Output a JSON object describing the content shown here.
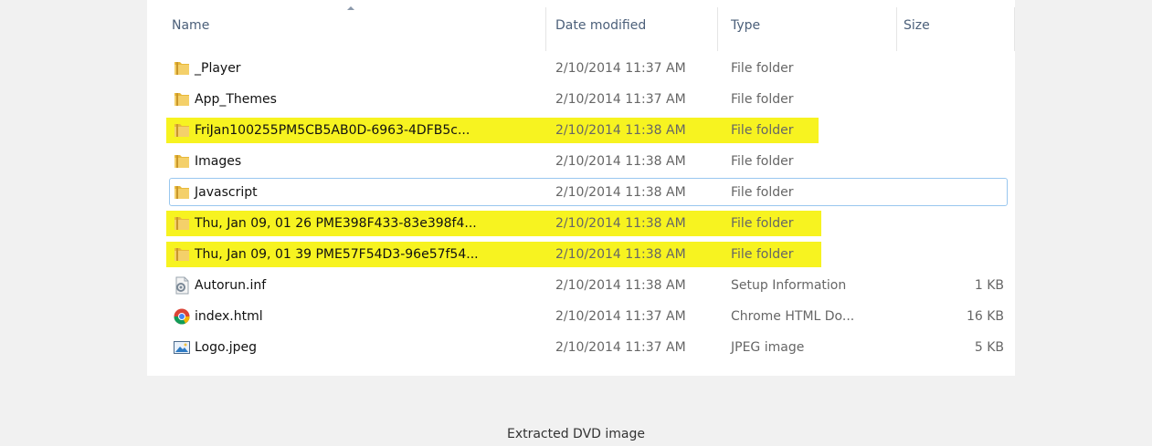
{
  "columns": {
    "name": "Name",
    "date_modified": "Date modified",
    "type": "Type",
    "size": "Size"
  },
  "files": [
    {
      "name": "_Player",
      "date": "2/10/2014 11:37 AM",
      "type": "File folder",
      "size": "",
      "icon": "folder-icon",
      "highlighted": false
    },
    {
      "name": "App_Themes",
      "date": "2/10/2014 11:37 AM",
      "type": "File folder",
      "size": "",
      "icon": "folder-icon",
      "highlighted": false
    },
    {
      "name": "FriJan100255PM5CB5AB0D-6963-4DFB5c...",
      "date": "2/10/2014 11:38 AM",
      "type": "File folder",
      "size": "",
      "icon": "folder-icon",
      "highlighted": true
    },
    {
      "name": "Images",
      "date": "2/10/2014 11:38 AM",
      "type": "File folder",
      "size": "",
      "icon": "folder-icon",
      "highlighted": false
    },
    {
      "name": "Javascript",
      "date": "2/10/2014 11:38 AM",
      "type": "File folder",
      "size": "",
      "icon": "folder-icon",
      "highlighted": false,
      "focused": true
    },
    {
      "name": "Thu, Jan 09, 01 26 PME398F433-83e398f4...",
      "date": "2/10/2014 11:38 AM",
      "type": "File folder",
      "size": "",
      "icon": "folder-icon",
      "highlighted": true
    },
    {
      "name": "Thu, Jan 09, 01 39 PME57F54D3-96e57f54...",
      "date": "2/10/2014 11:38 AM",
      "type": "File folder",
      "size": "",
      "icon": "folder-icon",
      "highlighted": true
    },
    {
      "name": "Autorun.inf",
      "date": "2/10/2014 11:38 AM",
      "type": "Setup Information",
      "size": "1 KB",
      "icon": "settings-file-icon",
      "highlighted": false
    },
    {
      "name": "index.html",
      "date": "2/10/2014 11:37 AM",
      "type": "Chrome HTML Do...",
      "size": "16 KB",
      "icon": "chrome-icon",
      "highlighted": false
    },
    {
      "name": "Logo.jpeg",
      "date": "2/10/2014 11:37 AM",
      "type": "JPEG image",
      "size": "5 KB",
      "icon": "image-file-icon",
      "highlighted": false
    }
  ],
  "caption": "Extracted DVD image",
  "colors": {
    "highlight": "#f7f320",
    "folder": "#e8b93a",
    "focus_border": "#99c7ef"
  }
}
